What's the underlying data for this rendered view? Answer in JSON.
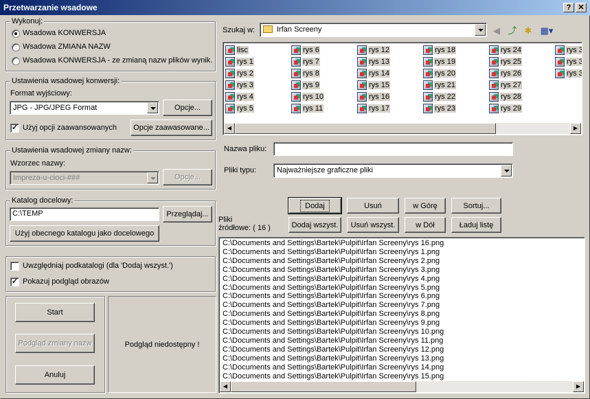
{
  "window": {
    "title": "Przetwarzanie wsadowe",
    "help_btn": "?",
    "close_btn": "✕"
  },
  "execute": {
    "label": "Wykonuj:",
    "options": [
      "Wsadowa  KONWERSJA",
      "Wsadowa  ZMIANA NAZW",
      "Wsadowa  KONWERSJA - ze zmianą nazw plików wynik."
    ],
    "selected": 0
  },
  "conversion": {
    "label": "Ustawienia wsadowej konwersji:",
    "format_label": "Format wyjściowy:",
    "format_value": "JPG - JPG/JPEG Format",
    "options_btn": "Opcje...",
    "advanced_check": "Użyj opcji zaawansowanych",
    "advanced_btn": "Opcje zaawasowane..."
  },
  "rename": {
    "label": "Ustawienia wsadowej zmiany nazw:",
    "pattern_label": "Wzorzec nazwy:",
    "pattern_value": "Impreza-u-cioci-###",
    "options_btn": "Opcje..."
  },
  "target": {
    "label": "Katalog docelowy:",
    "path": "C:\\TEMP",
    "browse_btn": "Przeglądaj...",
    "use_current_btn": "Użyj obecnego katalogu jako docelowego"
  },
  "misc": {
    "subdirs_check": "Uwzględniaj podkatalogi  (dla 'Dodaj wszyst.')",
    "preview_check": "Pokazuj podgląd obrazów"
  },
  "actions": {
    "start": "Start",
    "rename_preview": "Podgląd zmiany nazw",
    "cancel": "Anuluj"
  },
  "preview_text": "Podgląd niedostępny !",
  "browser": {
    "look_in_label": "Szukaj w:",
    "look_in_value": "Irfan Screeny",
    "columns": [
      [
        "lisc",
        "rys 1",
        "rys 2",
        "rys 3",
        "rys 4",
        "rys 5"
      ],
      [
        "rys 6",
        "rys 7",
        "rys 8",
        "rys 9",
        "rys 10",
        "rys 11"
      ],
      [
        "rys 12",
        "rys 13",
        "rys 14",
        "rys 15",
        "rys 16",
        "rys 17"
      ],
      [
        "rys 18",
        "rys 19",
        "rys 20",
        "rys 21",
        "rys 22",
        "rys 23"
      ],
      [
        "rys 24",
        "rys 25",
        "rys 26",
        "rys 27",
        "rys 28",
        "rys 29"
      ],
      [
        "rys 3",
        "rys 3",
        "rys 3"
      ]
    ],
    "filename_label": "Nazwa pliku:",
    "filename_value": "",
    "filetype_label": "Pliki typu:",
    "filetype_value": "Najważniejsze graficzne pliki"
  },
  "source_buttons": {
    "add": "Dodaj",
    "remove": "Usuń",
    "up": "w Górę",
    "sort": "Sortuj...",
    "add_all": "Dodaj wszyst.",
    "remove_all": "Usuń wszyst.",
    "down": "w Dół",
    "load_list": "Ładuj listę"
  },
  "source": {
    "label_line1": "Pliki",
    "label_line2": "źródłowe: ( 16 )",
    "files": [
      "C:\\Documents and Settings\\Bartek\\Pulpit\\Irfan Screeny\\rys 16.png",
      "C:\\Documents and Settings\\Bartek\\Pulpit\\Irfan Screeny\\rys 1.png",
      "C:\\Documents and Settings\\Bartek\\Pulpit\\Irfan Screeny\\rys 2.png",
      "C:\\Documents and Settings\\Bartek\\Pulpit\\Irfan Screeny\\rys 3.png",
      "C:\\Documents and Settings\\Bartek\\Pulpit\\Irfan Screeny\\rys 4.png",
      "C:\\Documents and Settings\\Bartek\\Pulpit\\Irfan Screeny\\rys 5.png",
      "C:\\Documents and Settings\\Bartek\\Pulpit\\Irfan Screeny\\rys 6.png",
      "C:\\Documents and Settings\\Bartek\\Pulpit\\Irfan Screeny\\rys 7.png",
      "C:\\Documents and Settings\\Bartek\\Pulpit\\Irfan Screeny\\rys 8.png",
      "C:\\Documents and Settings\\Bartek\\Pulpit\\Irfan Screeny\\rys 9.png",
      "C:\\Documents and Settings\\Bartek\\Pulpit\\Irfan Screeny\\rys 10.png",
      "C:\\Documents and Settings\\Bartek\\Pulpit\\Irfan Screeny\\rys 11.png",
      "C:\\Documents and Settings\\Bartek\\Pulpit\\Irfan Screeny\\rys 12.png",
      "C:\\Documents and Settings\\Bartek\\Pulpit\\Irfan Screeny\\rys 13.png",
      "C:\\Documents and Settings\\Bartek\\Pulpit\\Irfan Screeny\\rys 14.png",
      "C:\\Documents and Settings\\Bartek\\Pulpit\\Irfan Screeny\\rys 15.png"
    ]
  },
  "colors": {
    "titlebar_start": "#0a246a",
    "titlebar_end": "#a6caf0",
    "face": "#d4d0c8"
  }
}
